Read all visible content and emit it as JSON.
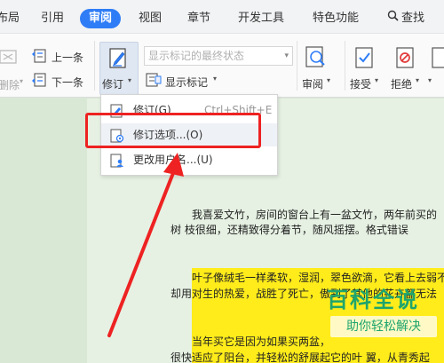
{
  "menu_tabs": [
    {
      "label": "布局"
    },
    {
      "label": "引用"
    },
    {
      "label": "审阅",
      "active": true
    },
    {
      "label": "视图"
    },
    {
      "label": "章节"
    },
    {
      "label": "开发工具"
    },
    {
      "label": "特色功能"
    },
    {
      "label": "查找"
    }
  ],
  "ribbon": {
    "delete_label": "删除",
    "prev_label": "上一条",
    "next_label": "下一条",
    "revise_label": "修订",
    "status_placeholder": "显示标记的最终状态",
    "show_markup_label": "显示标记",
    "review_pane_label": "审阅",
    "accept_label": "接受",
    "reject_label": "拒绝"
  },
  "dropdown": {
    "items": [
      {
        "label": "修订(G)",
        "shortcut": "Ctrl+Shift+E"
      },
      {
        "label": "修订选项...(O)",
        "shortcut": ""
      },
      {
        "label": "更改用户名...(U)",
        "shortcut": ""
      }
    ]
  },
  "document": {
    "lines": [
      "我喜爱文竹，房间的窗台上有一盆文竹，两年前买的",
      "树        枝很细，还精致得分着节，随风摇摆。格式错误",
      "叶子像绒毛一样柔软，湿润，翠色欲滴，它看上去弱不",
      "却用对生的热爱，战胜了死亡，傲到了其他的花卉都无法",
      "当年买它是因为如果买两盆，",
      "很快适应了阳台，并轻松的舒展起它的叶 翼，从青秀起"
    ]
  },
  "watermark": {
    "title": "百科全说",
    "subtitle": "助你轻松解决"
  },
  "colors": {
    "accent": "#2f7df6",
    "highlight": "#ffec1a",
    "annotation": "#ee2222",
    "watermark": "#1ea56d"
  }
}
